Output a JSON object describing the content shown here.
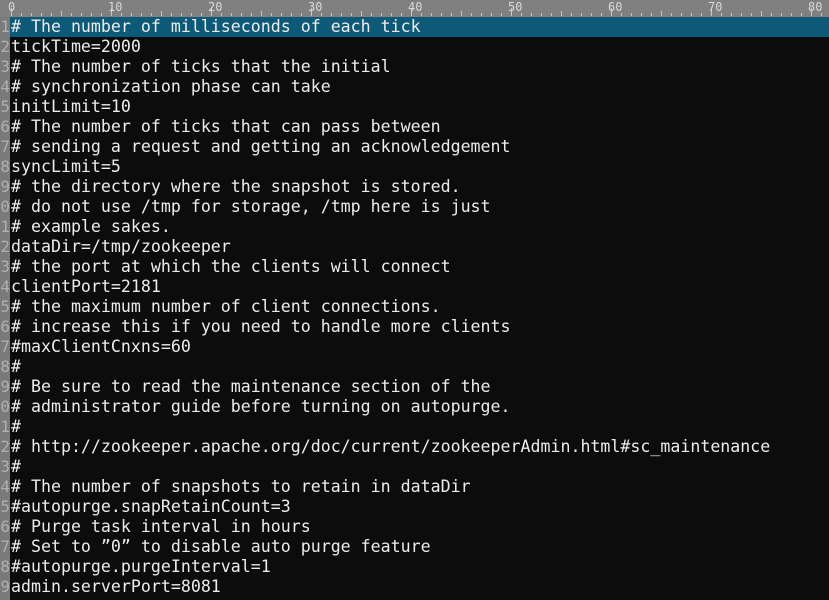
{
  "ruler": {
    "labels": [
      "0",
      "10",
      "20",
      "30",
      "40",
      "50",
      "60",
      "70",
      "80"
    ]
  },
  "colors": {
    "background": "#0c0c0c",
    "text": "#ececec",
    "current_line": "#0d5a78",
    "gutter": "#7a7a7a",
    "ruler": "#808080"
  },
  "editor": {
    "current_line": 1,
    "lines": [
      "# The number of milliseconds of each tick",
      "tickTime=2000",
      "# The number of ticks that the initial",
      "# synchronization phase can take",
      "initLimit=10",
      "# The number of ticks that can pass between",
      "# sending a request and getting an acknowledgement",
      "syncLimit=5",
      "# the directory where the snapshot is stored.",
      "# do not use /tmp for storage, /tmp here is just",
      "# example sakes.",
      "dataDir=/tmp/zookeeper",
      "# the port at which the clients will connect",
      "clientPort=2181",
      "# the maximum number of client connections.",
      "# increase this if you need to handle more clients",
      "#maxClientCnxns=60",
      "#",
      "# Be sure to read the maintenance section of the",
      "# administrator guide before turning on autopurge.",
      "#",
      "# http://zookeeper.apache.org/doc/current/zookeeperAdmin.html#sc_maintenance",
      "#",
      "# The number of snapshots to retain in dataDir",
      "#autopurge.snapRetainCount=3",
      "# Purge task interval in hours",
      "# Set to ”0” to disable auto purge feature",
      "#autopurge.purgeInterval=1",
      "admin.serverPort=8081"
    ]
  }
}
